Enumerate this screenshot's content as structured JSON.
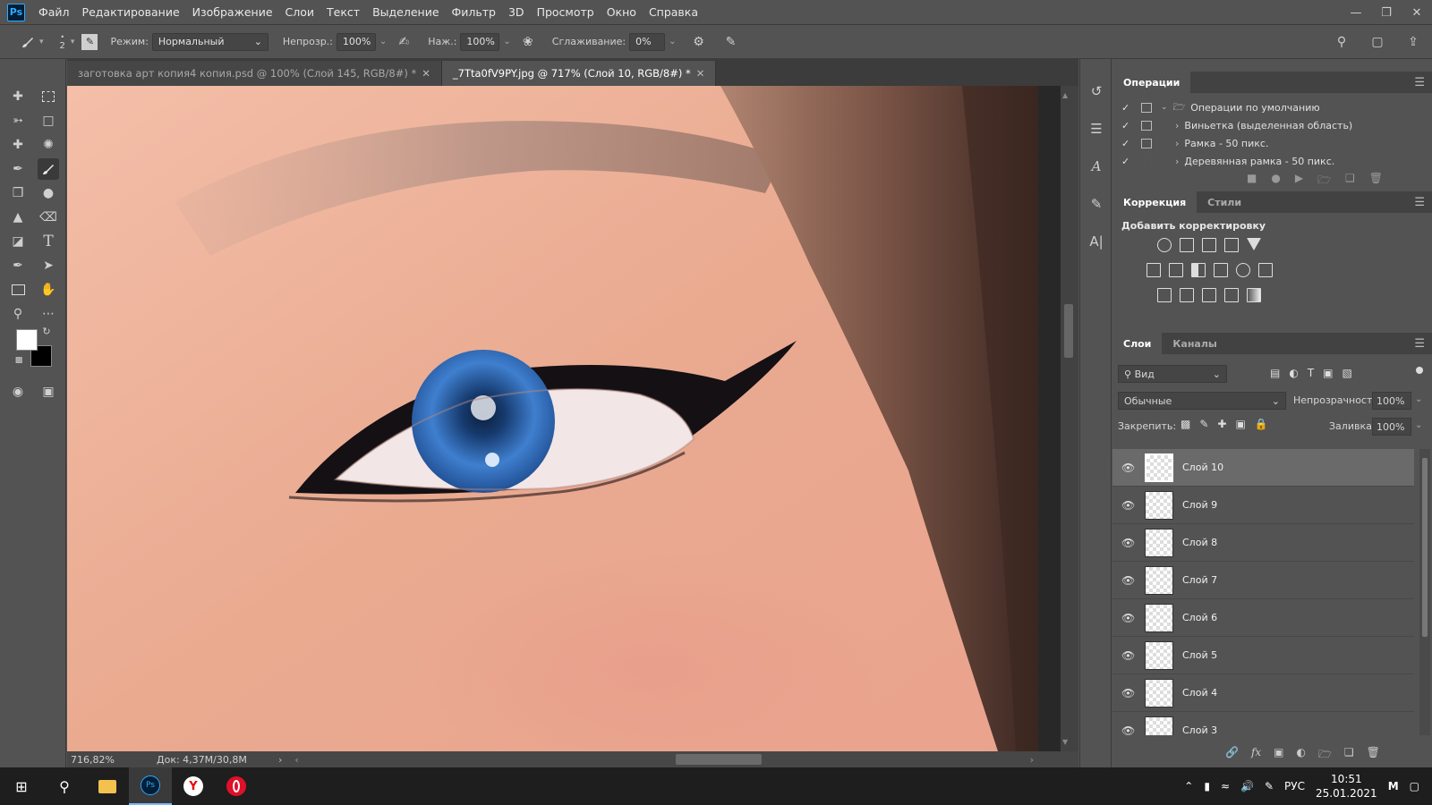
{
  "app": {
    "logo": "Ps"
  },
  "menu": [
    "Файл",
    "Редактирование",
    "Изображение",
    "Слои",
    "Текст",
    "Выделение",
    "Фильтр",
    "3D",
    "Просмотр",
    "Окно",
    "Справка"
  ],
  "options": {
    "brush_size": "2",
    "mode_label": "Режим:",
    "mode_value": "Нормальный",
    "opacity_label": "Непрозр.:",
    "opacity_value": "100%",
    "pressure_label": "Наж.:",
    "pressure_value": "100%",
    "smoothing_label": "Сглаживание:",
    "smoothing_value": "0%"
  },
  "tabs": [
    {
      "label": "заготовка арт копия4 копия.psd @ 100% (Слой 145, RGB/8#) *",
      "active": false
    },
    {
      "label": "_7Tta0fV9PY.jpg @ 717% (Слой 10, RGB/8#) *",
      "active": true
    }
  ],
  "status": {
    "zoom": "716,82%",
    "doc": "Док: 4,37M/30,8M"
  },
  "operations": {
    "title": "Операции",
    "items": [
      {
        "label": "Операции по умолчанию",
        "type": "folder"
      },
      {
        "label": "Виньетка (выделенная область)",
        "type": "action"
      },
      {
        "label": "Рамка - 50 пикс.",
        "type": "action"
      },
      {
        "label": "Деревянная рамка - 50 пикс.",
        "type": "action"
      }
    ]
  },
  "adjustments": {
    "tab_correction": "Коррекция",
    "tab_styles": "Стили",
    "add_label": "Добавить корректировку"
  },
  "layers": {
    "tab_layers": "Слои",
    "tab_channels": "Каналы",
    "filter_label": "Вид",
    "blend_mode": "Обычные",
    "opacity_label": "Непрозрачность:",
    "opacity_value": "100%",
    "lock_label": "Закрепить:",
    "fill_label": "Заливка:",
    "fill_value": "100%",
    "items": [
      {
        "name": "Слой 10",
        "selected": true
      },
      {
        "name": "Слой 9",
        "selected": false
      },
      {
        "name": "Слой 8",
        "selected": false
      },
      {
        "name": "Слой 7",
        "selected": false
      },
      {
        "name": "Слой 6",
        "selected": false
      },
      {
        "name": "Слой 5",
        "selected": false
      },
      {
        "name": "Слой 4",
        "selected": false
      },
      {
        "name": "Слой 3",
        "selected": false
      }
    ]
  },
  "taskbar": {
    "lang": "РУС",
    "time": "10:51",
    "date": "25.01.2021"
  },
  "colors": {
    "foreground": "#ffffff",
    "background": "#000000",
    "accent": "#31a8ff"
  }
}
